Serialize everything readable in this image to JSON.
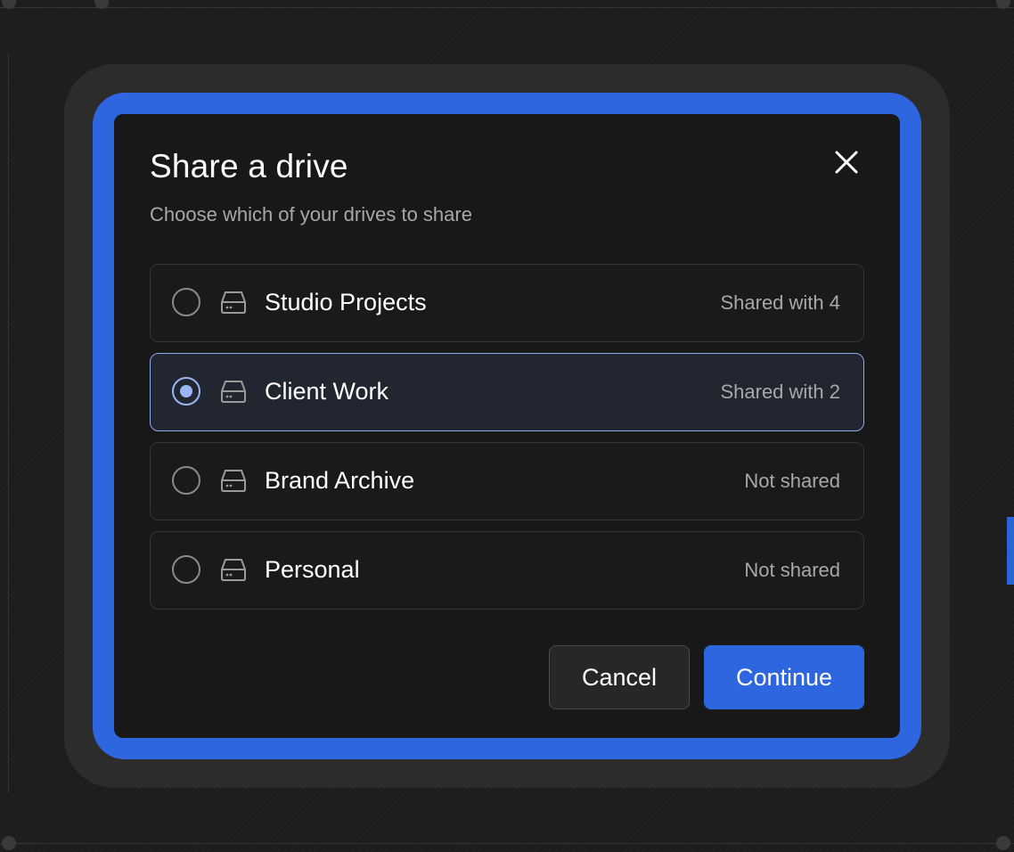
{
  "dialog": {
    "title": "Share a drive",
    "subtitle": "Choose which of your drives to share",
    "close_icon": "close-icon",
    "drives": [
      {
        "name": "Studio Projects",
        "status": "Shared with 4",
        "selected": false,
        "icon": "hard-drive-icon"
      },
      {
        "name": "Client Work",
        "status": "Shared with 2",
        "selected": true,
        "icon": "hard-drive-icon"
      },
      {
        "name": "Brand Archive",
        "status": "Not shared",
        "selected": false,
        "icon": "hard-drive-icon"
      },
      {
        "name": "Personal",
        "status": "Not shared",
        "selected": false,
        "icon": "hard-drive-icon"
      }
    ],
    "buttons": {
      "cancel_label": "Cancel",
      "continue_label": "Continue"
    }
  },
  "colors": {
    "accent": "#2e66e0",
    "selected_ring": "#9bb6f4",
    "dialog_bg": "#181818"
  }
}
